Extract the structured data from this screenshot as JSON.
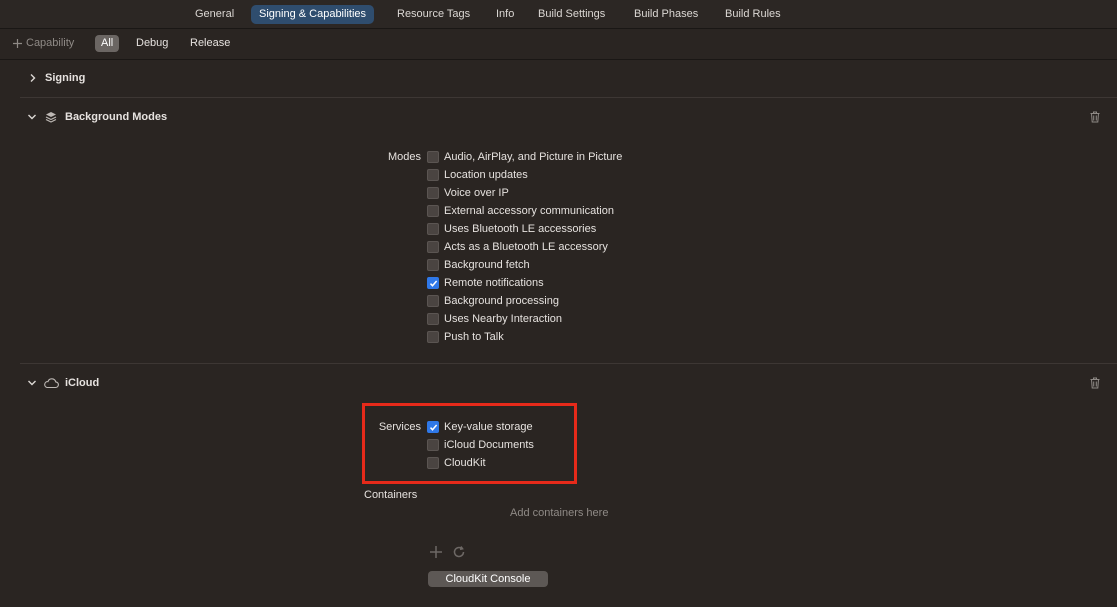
{
  "tabs": [
    {
      "label": "General"
    },
    {
      "label": "Signing & Capabilities"
    },
    {
      "label": "Resource Tags"
    },
    {
      "label": "Info"
    },
    {
      "label": "Build Settings"
    },
    {
      "label": "Build Phases"
    },
    {
      "label": "Build Rules"
    }
  ],
  "filter": {
    "add_capability": "Capability",
    "options": [
      "All",
      "Debug",
      "Release"
    ],
    "selected": "All"
  },
  "signing": {
    "title": "Signing"
  },
  "background_modes": {
    "title": "Background Modes",
    "modes_label": "Modes",
    "modes": [
      {
        "label": "Audio, AirPlay, and Picture in Picture",
        "checked": false
      },
      {
        "label": "Location updates",
        "checked": false
      },
      {
        "label": "Voice over IP",
        "checked": false
      },
      {
        "label": "External accessory communication",
        "checked": false
      },
      {
        "label": "Uses Bluetooth LE accessories",
        "checked": false
      },
      {
        "label": "Acts as a Bluetooth LE accessory",
        "checked": false
      },
      {
        "label": "Background fetch",
        "checked": false
      },
      {
        "label": "Remote notifications",
        "checked": true
      },
      {
        "label": "Background processing",
        "checked": false
      },
      {
        "label": "Uses Nearby Interaction",
        "checked": false
      },
      {
        "label": "Push to Talk",
        "checked": false
      }
    ]
  },
  "icloud": {
    "title": "iCloud",
    "services_label": "Services",
    "services": [
      {
        "label": "Key-value storage",
        "checked": true
      },
      {
        "label": "iCloud Documents",
        "checked": false
      },
      {
        "label": "CloudKit",
        "checked": false
      }
    ],
    "containers_label": "Containers",
    "containers_placeholder": "Add containers here",
    "console_button": "CloudKit Console"
  },
  "colors": {
    "background": "#2a2522",
    "active_tab": "#2f4d6e",
    "checkbox_on": "#2f78e8",
    "highlight": "#e62a1a"
  }
}
